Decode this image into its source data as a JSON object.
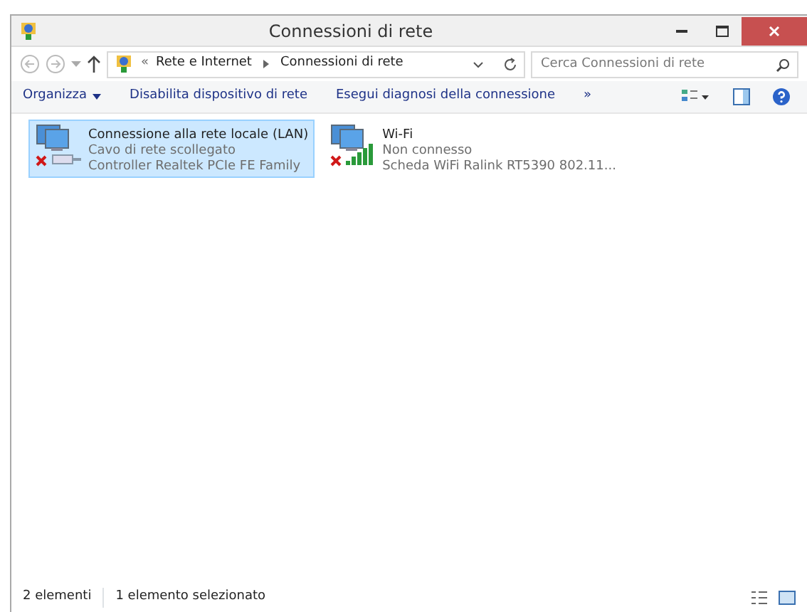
{
  "window": {
    "title": "Connessioni di rete"
  },
  "address_bar": {
    "prefix": "«",
    "breadcrumb": [
      "Rete e Internet",
      "Connessioni di rete"
    ]
  },
  "search": {
    "placeholder": "Cerca Connessioni di rete"
  },
  "toolbar": {
    "commands": [
      {
        "label": "Organizza",
        "dropdown": true
      },
      {
        "label": "Disabilita dispositivo di rete",
        "dropdown": false
      },
      {
        "label": "Esegui diagnosi della connessione",
        "dropdown": false
      }
    ],
    "more": "»"
  },
  "connections": [
    {
      "kind": "wired",
      "name": "Connessione alla rete locale (LAN)",
      "status": "Cavo di rete scollegato",
      "device": "Controller Realtek PCIe FE Family",
      "selected": true
    },
    {
      "kind": "wifi",
      "name": "Wi-Fi",
      "status": "Non connesso",
      "device": "Scheda WiFi Ralink RT5390 802.11...",
      "selected": false
    }
  ],
  "status_bar": [
    "2 elementi",
    "1 elemento selezionato"
  ]
}
